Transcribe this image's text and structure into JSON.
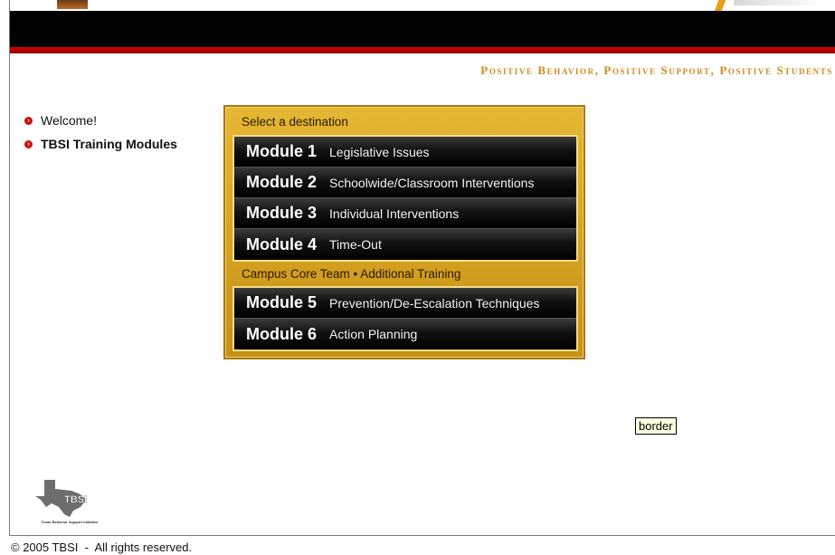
{
  "header": {
    "tagline": "Positive Behavior, Positive Support, Positive Students"
  },
  "side_nav": {
    "items": [
      {
        "label": "Welcome!",
        "bold": false
      },
      {
        "label": "TBSI Training Modules",
        "bold": true
      }
    ]
  },
  "menu": {
    "section_1_title": "Select a destination",
    "section_2_title": "Campus Core Team • Additional Training",
    "modules": [
      {
        "number": "Module 1",
        "title": "Legislative Issues"
      },
      {
        "number": "Module 2",
        "title": "Schoolwide/Classroom Interventions"
      },
      {
        "number": "Module 3",
        "title": "Individual Interventions"
      },
      {
        "number": "Module 4",
        "title": "Time-Out"
      },
      {
        "number": "Module 5",
        "title": "Prevention/De-Escalation Techniques"
      },
      {
        "number": "Module 6",
        "title": "Action Planning"
      }
    ]
  },
  "tooltip": {
    "text": "border"
  },
  "logo": {
    "text": "TBSI",
    "caption": "Texas Behavior Support Initiative"
  },
  "footer": {
    "copyright": "© 2005 TBSI  -  All rights reserved."
  },
  "colors": {
    "tagline": "#d28a1e",
    "menu_gold": "#e6b733",
    "bullet_red": "#cc1111",
    "red_bar": "#d80000"
  }
}
